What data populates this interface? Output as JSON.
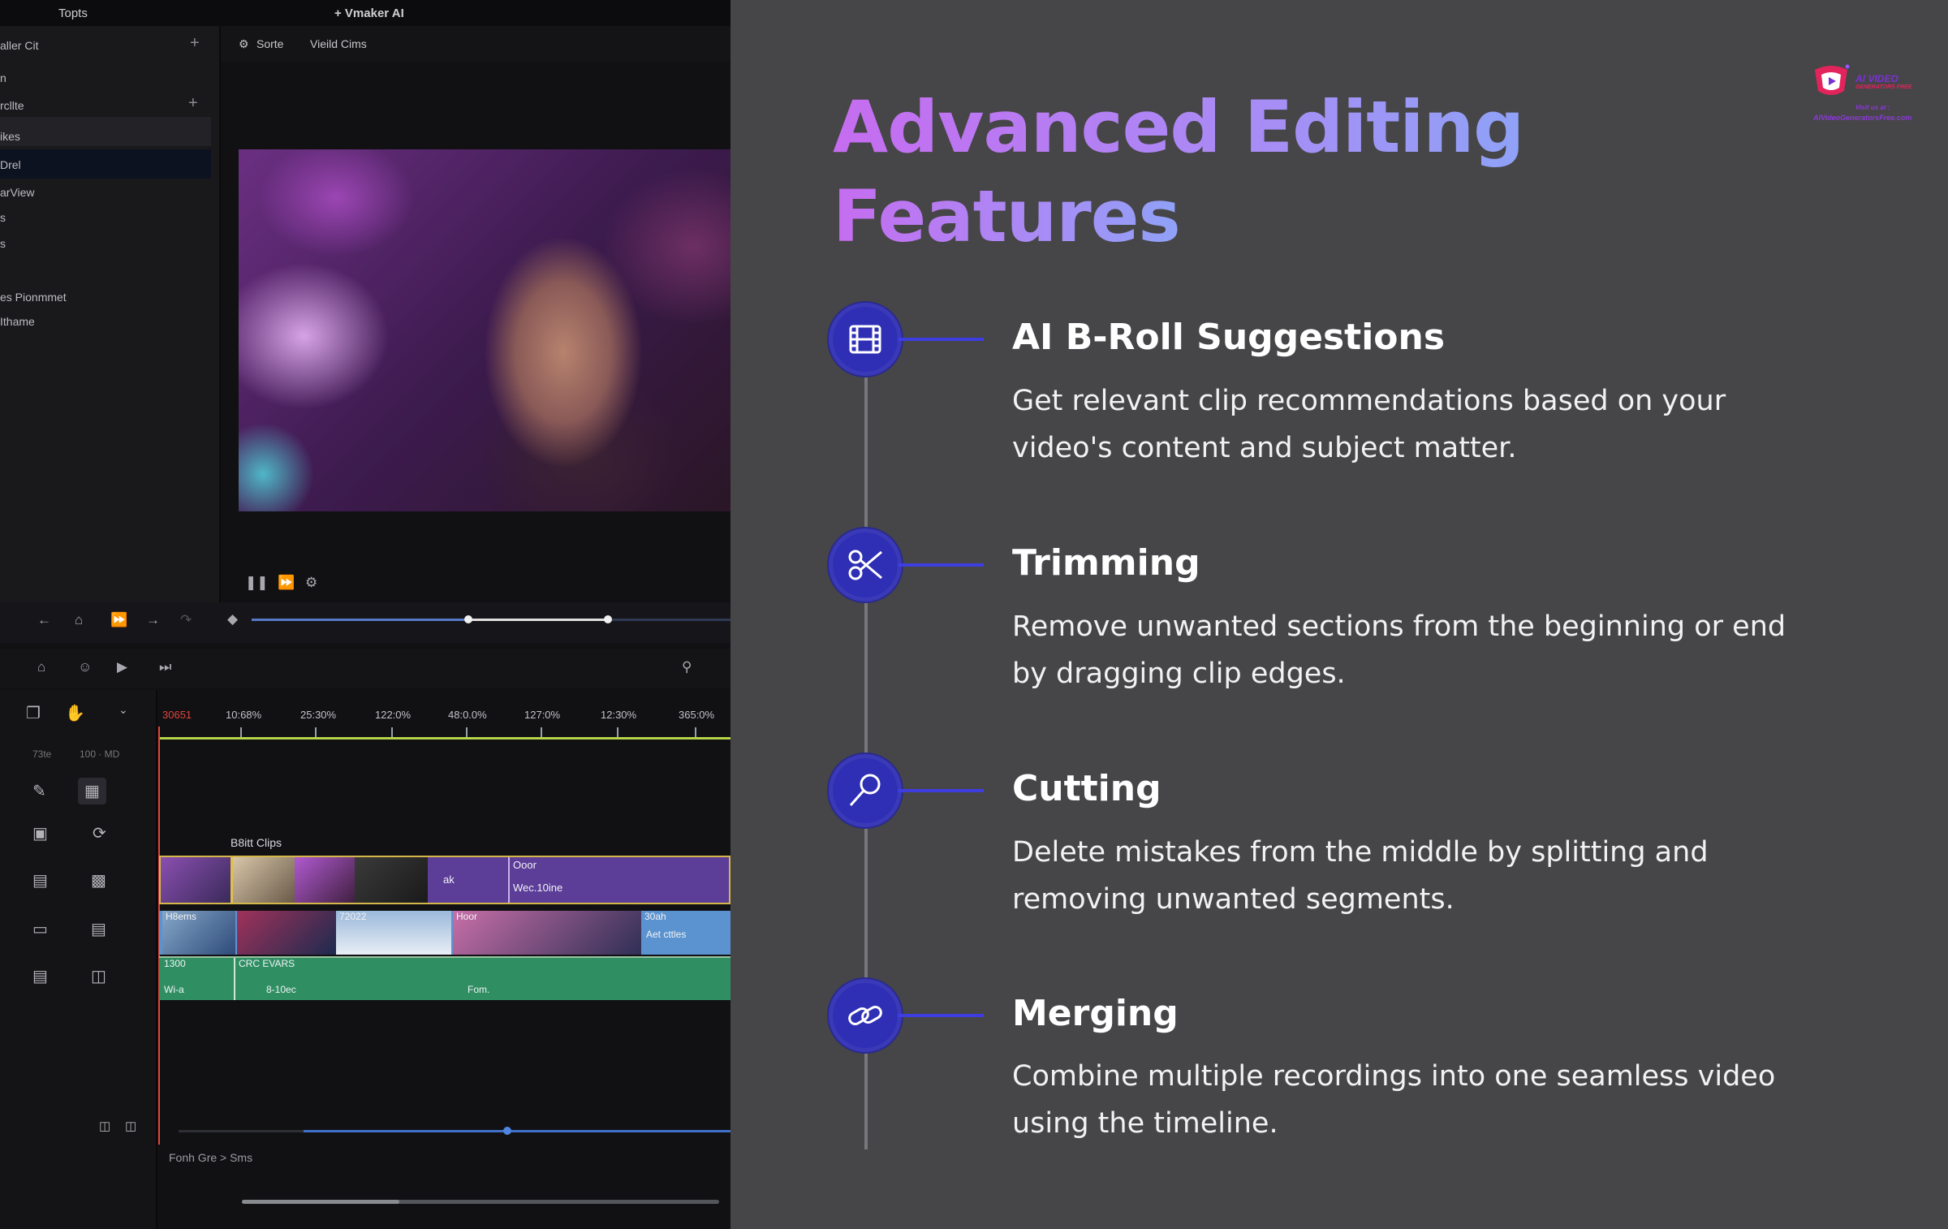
{
  "editor": {
    "topbar": {
      "left_label": "Topts",
      "center_label": "+ Vmaker AI"
    },
    "sidebar": {
      "header": "aller Cit",
      "items": [
        "n",
        "rcllte",
        "ikes",
        "Drel",
        "arView",
        "s",
        "s",
        "es Pionmmet",
        "Ithame"
      ]
    },
    "preview_tabs": [
      "Sorte",
      "Vieild Cims"
    ],
    "ruler": {
      "start": "30651",
      "ticks": [
        "10:68%",
        "25:30%",
        "122:0%",
        "48:0.0%",
        "127:0%",
        "12:30%",
        "365:0%"
      ]
    },
    "headers": {
      "col1": "73te",
      "col2": "100 · MD"
    },
    "clips_label": "B8itt Clips",
    "track1": {
      "label_a": "Ooor",
      "label_b": "Wec.10ine",
      "mark": "ak"
    },
    "track2": {
      "label_a": "H8ems",
      "label_b": "72022",
      "label_c": "Hoor",
      "label_d": "30ah",
      "label_e": "Aet cttles"
    },
    "track3": {
      "label_a": "1300",
      "label_b": "CRC EVARS",
      "label_c": "Wi-a",
      "label_d": "8-10ec",
      "label_e": "Fom."
    },
    "breadcrumb": "Fonh Gre > Sms"
  },
  "slide": {
    "title_line1": "Advanced Editing",
    "title_line2": "Features",
    "features": [
      {
        "icon": "film-icon",
        "title": "AI B-Roll Suggestions",
        "desc_line1": "Get relevant clip recommendations based on your",
        "desc_line2": "video's content and subject matter."
      },
      {
        "icon": "scissors-icon",
        "title": "Trimming",
        "desc_line1": "Remove unwanted sections from the beginning or end",
        "desc_line2": "by dragging clip edges."
      },
      {
        "icon": "knife-icon",
        "title": "Cutting",
        "desc_line1": "Delete mistakes from the middle by splitting and",
        "desc_line2": "removing unwanted segments."
      },
      {
        "icon": "link-icon",
        "title": "Merging",
        "desc_line1": "Combine multiple recordings into one seamless video",
        "desc_line2": "using the timeline."
      }
    ],
    "logo": {
      "line1": "AI VIDEO",
      "line2": "GENERATORS FREE",
      "line3": "Visit us at :",
      "line4": "AIVideoGeneratorsFree.com"
    },
    "colors": {
      "background": "#464547",
      "node": "#2f2fb5",
      "title_gradient_start": "#c66cf0",
      "title_gradient_end": "#8fa2f7"
    }
  }
}
